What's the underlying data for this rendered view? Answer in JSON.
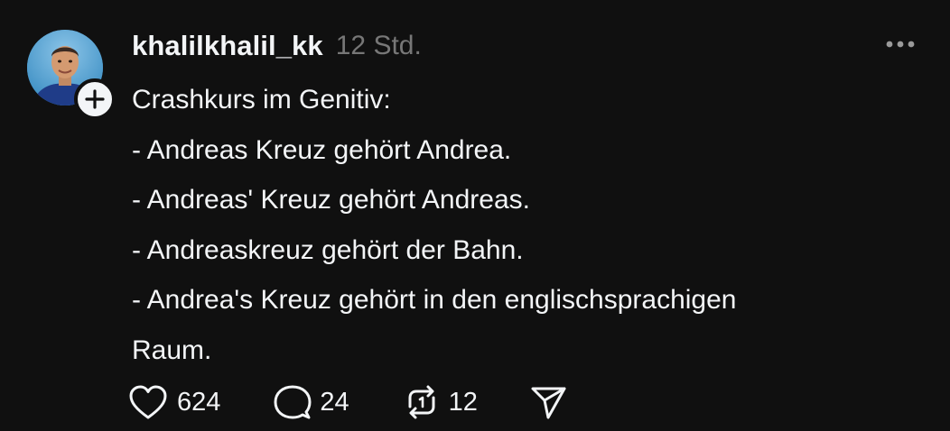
{
  "post": {
    "username": "khalilkhalil_kk",
    "time": "12 Std.",
    "text_lines": [
      "Crashkurs im Genitiv:",
      "- Andreas Kreuz gehört Andrea.",
      "- Andreas' Kreuz gehört Andreas.",
      "- Andreaskreuz gehört der Bahn.",
      "- Andrea's Kreuz gehört in den englischsprachigen",
      "Raum."
    ],
    "actions": {
      "likes": "624",
      "replies": "24",
      "reposts": "12"
    },
    "icons": {
      "avatar": "profile-photo",
      "follow": "plus-icon",
      "more": "more-horizontal-icon",
      "like": "heart-icon",
      "reply": "comment-icon",
      "repost": "repost-icon",
      "share": "send-icon"
    }
  },
  "colors": {
    "background": "#101010",
    "text": "#f3f5f7",
    "secondary": "#777777"
  }
}
